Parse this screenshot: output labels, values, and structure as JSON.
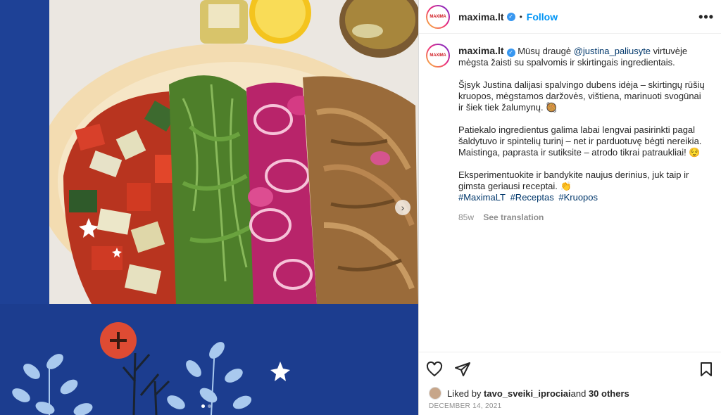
{
  "post": {
    "username": "maxima.lt",
    "avatar_text": "MAXIMA",
    "follow_label": "Follow",
    "dot_separator": "•",
    "more_label": "•••",
    "caption_intro_a": "Mūsų draugė ",
    "caption_mention": "@justina_paliusyte",
    "caption_intro_b": " virtuvėje mėgsta žaisti su spalvomis ir skirtingais ingredientais.",
    "paragraph_1": "Šįsyk Justina dalijasi spalvingo dubens idėja – skirtingų rūšių kruopos, mėgstamos daržovės, vištiena, marinuoti svogūnai ir šiek tiek žalumynų. 🥘",
    "paragraph_2": "Patiekalo ingredientus galima labai lengvai pasirinkti pagal šaldytuvo ir spintelių turinį – net ir parduotuvę bėgti nereikia. Maistinga, paprasta ir sutiksite – atrodo tikrai patraukliai! 😌",
    "paragraph_3": "Eksperimentuokite ir bandykite naujus derinius, juk taip ir gimsta geriausi receptai. 👏",
    "hashtags": [
      "#MaximaLT",
      "#Receptas",
      "#Kruopos"
    ],
    "age": "85w",
    "see_translation": "See translation",
    "liked_prefix": "Liked by ",
    "liked_user": "tavo_sveiki_iprociai",
    "liked_and": " and ",
    "liked_others": "30 others",
    "date": "DECEMBER 14, 2021"
  },
  "icons": {
    "verified": "verified-badge-icon",
    "like": "heart-icon",
    "share": "paper-plane-icon",
    "save": "bookmark-icon",
    "next": "chevron-right-icon"
  },
  "colors": {
    "brand_blue": "#1c3d8f",
    "link": "#0095f6",
    "verified": "#3897f0"
  }
}
